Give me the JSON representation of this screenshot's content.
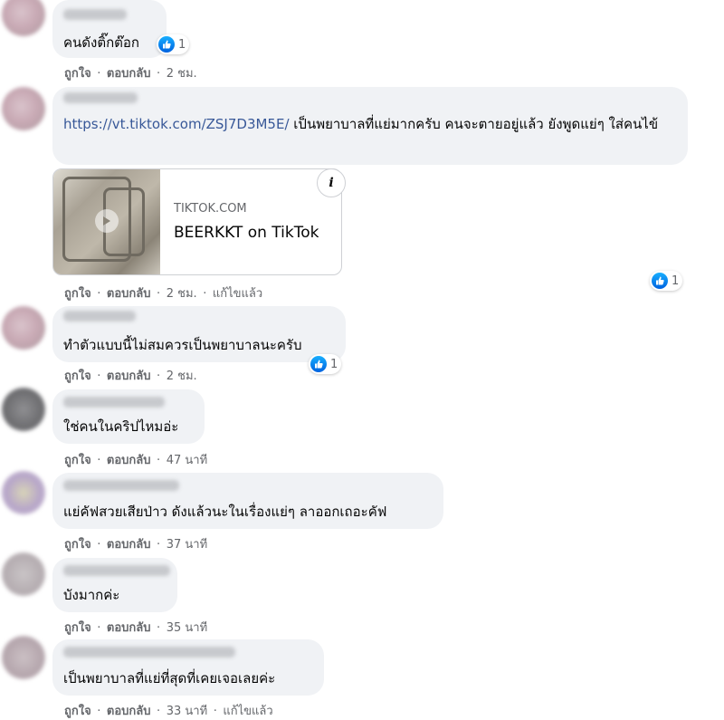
{
  "comments": [
    {
      "text": "คนดังติ๊กต๊อก",
      "likes": "1",
      "actions": {
        "like": "ถูกใจ",
        "reply": "ตอบกลับ",
        "time": "2 ชม."
      }
    },
    {
      "link": "https://vt.tiktok.com/ZSJ7D3M5E/",
      "text": "เป็นพยาบาลที่แย่มากครับ คนจะตายอยู่แล้ว ยังพูดแย่ๆ ใส่คนไข้",
      "preview": {
        "domain": "TIKTOK.COM",
        "title": "BEERKKT on TikTok"
      },
      "likes": "1",
      "actions": {
        "like": "ถูกใจ",
        "reply": "ตอบกลับ",
        "time": "2 ชม.",
        "edited": "แก้ไขแล้ว"
      }
    },
    {
      "text": "ทำตัวแบบนี้ไม่สมควรเป็นพยาบาลนะครับ",
      "likes": "1",
      "actions": {
        "like": "ถูกใจ",
        "reply": "ตอบกลับ",
        "time": "2 ชม."
      }
    },
    {
      "text": "ใช่คนในคริปไหมอ่ะ",
      "actions": {
        "like": "ถูกใจ",
        "reply": "ตอบกลับ",
        "time": "47 นาที"
      }
    },
    {
      "text": "แย่คัฟสวยเสียป่าว ดังแล้วนะในเรื่องแย่ๆ ลาออกเถอะคัฟ",
      "actions": {
        "like": "ถูกใจ",
        "reply": "ตอบกลับ",
        "time": "37 นาที"
      }
    },
    {
      "text": "บังมากค่ะ",
      "actions": {
        "like": "ถูกใจ",
        "reply": "ตอบกลับ",
        "time": "35 นาที"
      }
    },
    {
      "text": "เป็นพยาบาลที่แย่ที่สุดที่เคยเจอเลยค่ะ",
      "actions": {
        "like": "ถูกใจ",
        "reply": "ตอบกลับ",
        "time": "33 นาที",
        "edited": "แก้ไขแล้ว"
      }
    }
  ],
  "separator": "·",
  "info_label": "i",
  "colors": {
    "bubble": "#f0f2f5",
    "link": "#385898",
    "like_blue": "#1877f2",
    "meta": "#65676b"
  }
}
